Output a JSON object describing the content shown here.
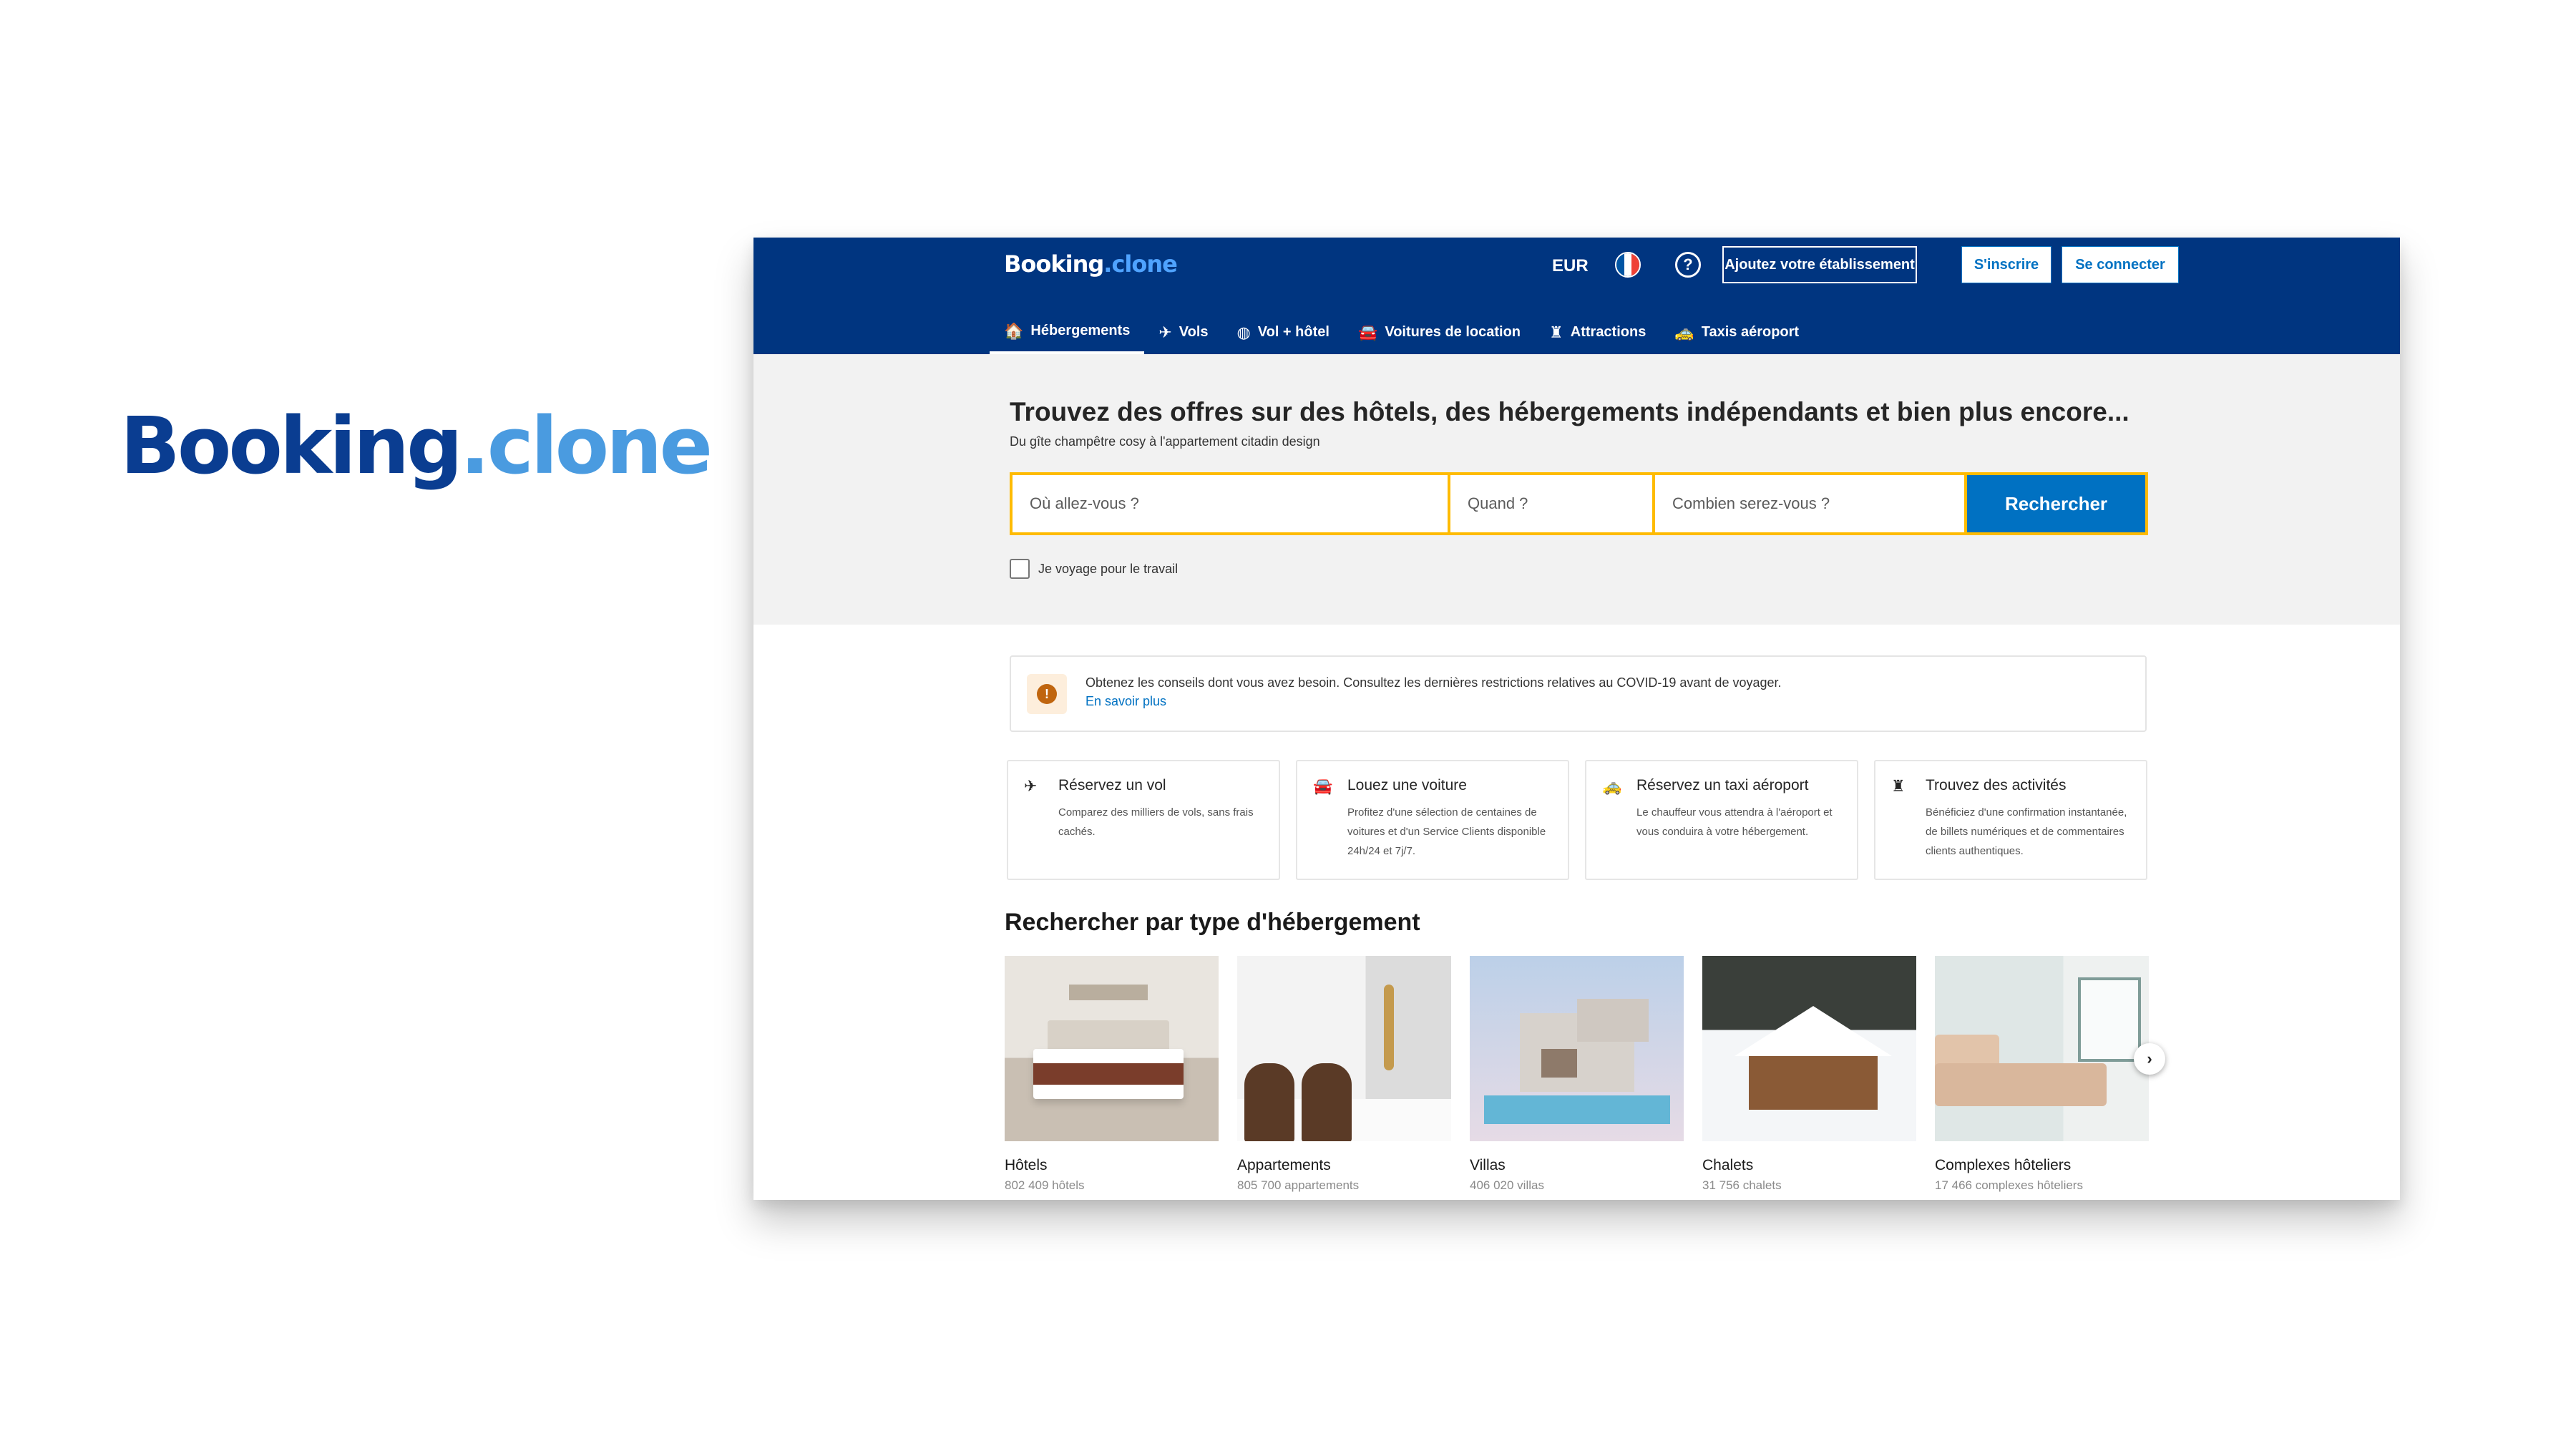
{
  "brand": {
    "name": "Booking",
    "suffix": ".clone"
  },
  "header": {
    "logo_main": "Booking",
    "logo_suffix": ".clone",
    "currency": "EUR",
    "help_glyph": "?",
    "add_property": "Ajoutez votre établissement",
    "register": "S'inscrire",
    "login": "Se connecter",
    "flag_colors": [
      "#0055a4",
      "#ffffff",
      "#ef4135"
    ]
  },
  "nav": [
    {
      "icon": "bed-icon",
      "glyph": "🏠",
      "label": "Hébergements",
      "active": true
    },
    {
      "icon": "plane-icon",
      "glyph": "✈",
      "label": "Vols"
    },
    {
      "icon": "globe-icon",
      "glyph": "◍",
      "label": "Vol + hôtel"
    },
    {
      "icon": "car-icon",
      "glyph": "🚘",
      "label": "Voitures de location"
    },
    {
      "icon": "attraction-icon",
      "glyph": "♜",
      "label": "Attractions"
    },
    {
      "icon": "taxi-icon",
      "glyph": "🚕",
      "label": "Taxis aéroport"
    }
  ],
  "hero": {
    "title": "Trouvez des offres sur des hôtels, des hébergements indépendants et bien plus encore...",
    "subtitle": "Du gîte champêtre cosy à l'appartement citadin design"
  },
  "search": {
    "destination_placeholder": "Où allez-vous ?",
    "dates_placeholder": "Quand ?",
    "guests_placeholder": "Combien serez-vous ?",
    "button": "Rechercher",
    "work_travel_label": "Je voyage pour le travail"
  },
  "notice": {
    "text": "Obtenez les conseils dont vous avez besoin. Consultez les dernières restrictions relatives au COVID-19 avant de voyager.",
    "link": "En savoir plus"
  },
  "cards": [
    {
      "icon": "plane-icon",
      "glyph": "✈",
      "title": "Réservez un vol",
      "desc": "Comparez des milliers de vols, sans frais cachés."
    },
    {
      "icon": "car-icon",
      "glyph": "🚘",
      "title": "Louez une voiture",
      "desc": "Profitez d'une sélection de centaines de voitures et d'un Service Clients disponible 24h/24 et 7j/7."
    },
    {
      "icon": "taxi-icon",
      "glyph": "🚕",
      "title": "Réservez un taxi aéroport",
      "desc": "Le chauffeur vous attendra à l'aéroport et vous conduira à votre hébergement."
    },
    {
      "icon": "attraction-icon",
      "glyph": "♜",
      "title": "Trouvez des activités",
      "desc": "Bénéficiez d'une confirmation instantanée, de billets numériques et de commentaires clients authentiques."
    }
  ],
  "types_section": {
    "title": "Rechercher par type d'hébergement",
    "next_glyph": "›",
    "items": [
      {
        "name": "Hôtels",
        "count": "802 409 hôtels"
      },
      {
        "name": "Appartements",
        "count": "805 700 appartements"
      },
      {
        "name": "Villas",
        "count": "406 020 villas"
      },
      {
        "name": "Chalets",
        "count": "31 756 chalets"
      },
      {
        "name": "Complexes hôteliers",
        "count": "17 466 complexes hôteliers"
      }
    ]
  }
}
